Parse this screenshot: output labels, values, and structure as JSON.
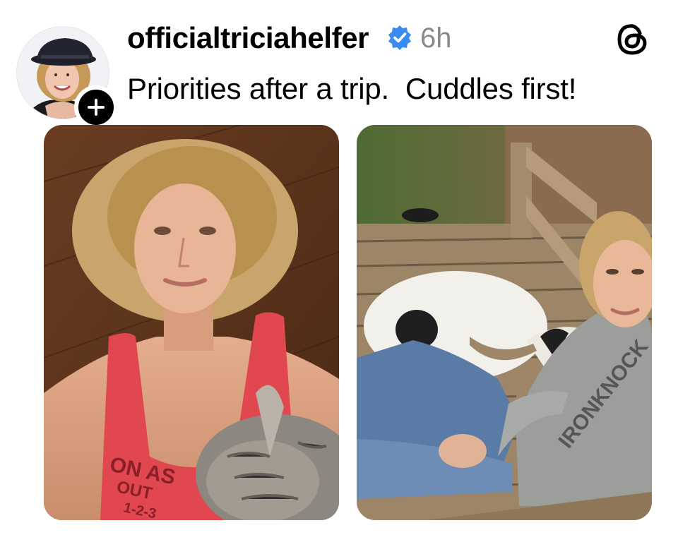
{
  "post": {
    "username": "officialtriciahelfer",
    "verified": true,
    "timestamp": "6h",
    "caption": "Priorities after a trip.  Cuddles first!"
  },
  "avatar": {
    "alt": "profile-photo"
  },
  "follow_button": {
    "icon": "plus-icon"
  },
  "app_logo": {
    "icon": "threads-logo-icon"
  },
  "photos": [
    {
      "id": "photo-1",
      "subject": "woman lying on wood floor with tabby cat",
      "shirt_text": "ON AS\nOUT\n1-2-3"
    },
    {
      "id": "photo-2",
      "subject": "woman on wooden deck cuddling horned goat",
      "sweatshirt_text": "IRONKNOCK"
    }
  ],
  "colors": {
    "verified_blue": "#3a8bf0",
    "timestamp_gray": "#8a8a8a",
    "text_black": "#000000"
  }
}
